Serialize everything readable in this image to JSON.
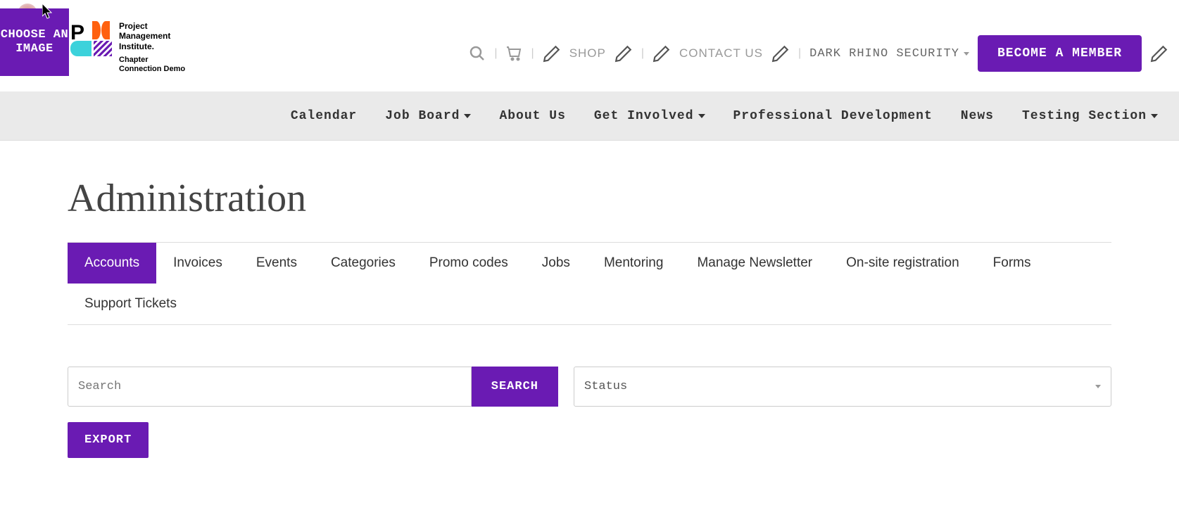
{
  "overlay": {
    "choose_image_label": "CHOOSE AN IMAGE"
  },
  "logo": {
    "line1": "Project",
    "line2": "Management",
    "line3": "Institute.",
    "line4": "Chapter",
    "line5": "Connection Demo"
  },
  "top_nav": {
    "shop": "SHOP",
    "contact": "CONTACT US",
    "user": "DARK RHINO SECURITY",
    "cta": "BECOME A MEMBER"
  },
  "main_nav": {
    "items": [
      {
        "label": "Calendar",
        "dropdown": false
      },
      {
        "label": "Job Board",
        "dropdown": true
      },
      {
        "label": "About Us",
        "dropdown": false
      },
      {
        "label": "Get Involved",
        "dropdown": true
      },
      {
        "label": "Professional Development",
        "dropdown": false
      },
      {
        "label": "News",
        "dropdown": false
      },
      {
        "label": "Testing Section",
        "dropdown": true
      }
    ]
  },
  "page": {
    "title": "Administration"
  },
  "admin_tabs": {
    "items": [
      {
        "label": "Accounts",
        "active": true
      },
      {
        "label": "Invoices",
        "active": false
      },
      {
        "label": "Events",
        "active": false
      },
      {
        "label": "Categories",
        "active": false
      },
      {
        "label": "Promo codes",
        "active": false
      },
      {
        "label": "Jobs",
        "active": false
      },
      {
        "label": "Mentoring",
        "active": false
      },
      {
        "label": "Manage Newsletter",
        "active": false
      },
      {
        "label": "On-site registration",
        "active": false
      },
      {
        "label": "Forms",
        "active": false
      },
      {
        "label": "Support Tickets",
        "active": false
      }
    ]
  },
  "search": {
    "placeholder": "Search",
    "button": "SEARCH",
    "status_placeholder": "Status",
    "export": "EXPORT"
  }
}
